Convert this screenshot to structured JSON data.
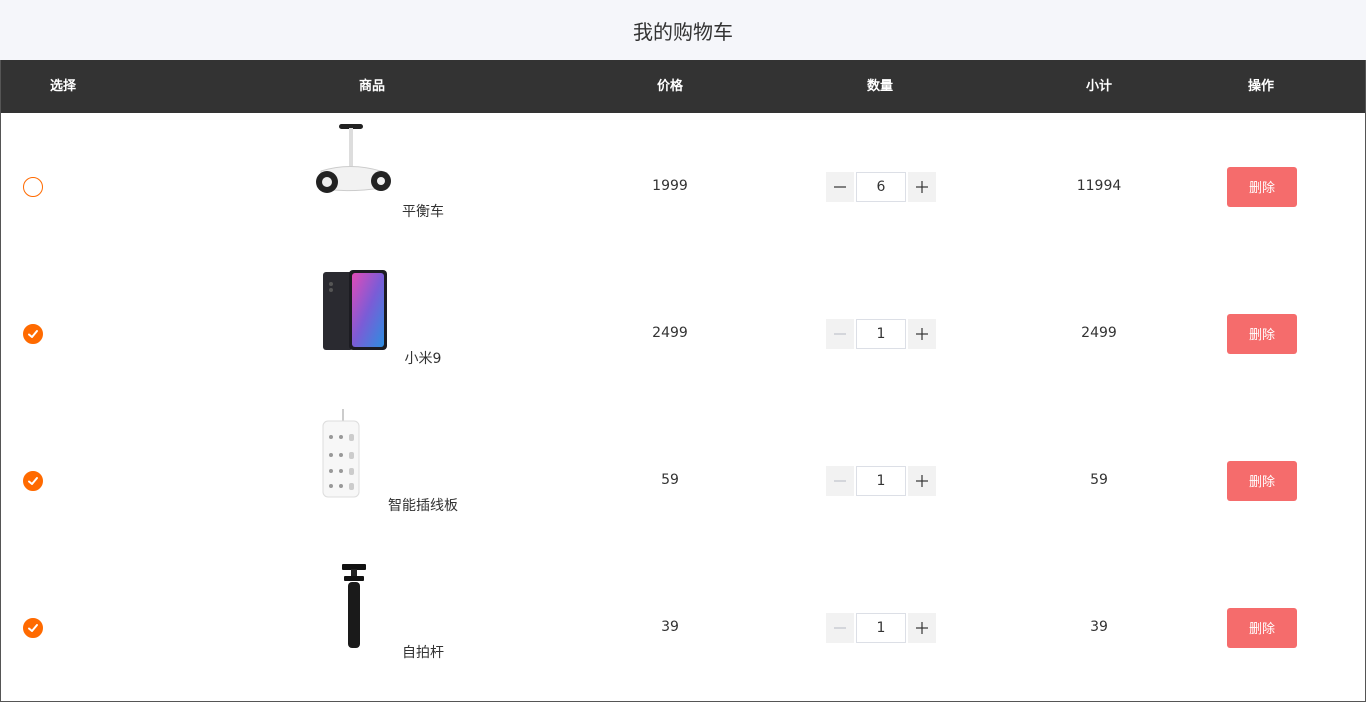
{
  "header": {
    "title": "我的购物车"
  },
  "columns": {
    "select": "选择",
    "product": "商品",
    "price": "价格",
    "quantity": "数量",
    "subtotal": "小计",
    "action": "操作"
  },
  "colors": {
    "accent": "#ff6a00",
    "header_bg": "#333333",
    "delete": "#f56c6c"
  },
  "items": [
    {
      "name": "平衡车",
      "price": "1999",
      "quantity": "6",
      "subtotal": "11994",
      "checked": false,
      "delete_label": "删除",
      "image": "balance-scooter"
    },
    {
      "name": "小米9",
      "price": "2499",
      "quantity": "1",
      "subtotal": "2499",
      "checked": true,
      "delete_label": "删除",
      "image": "smartphone"
    },
    {
      "name": "智能插线板",
      "price": "59",
      "quantity": "1",
      "subtotal": "59",
      "checked": true,
      "delete_label": "删除",
      "image": "power-strip"
    },
    {
      "name": "自拍杆",
      "price": "39",
      "quantity": "1",
      "subtotal": "39",
      "checked": true,
      "delete_label": "删除",
      "image": "selfie-stick"
    }
  ]
}
